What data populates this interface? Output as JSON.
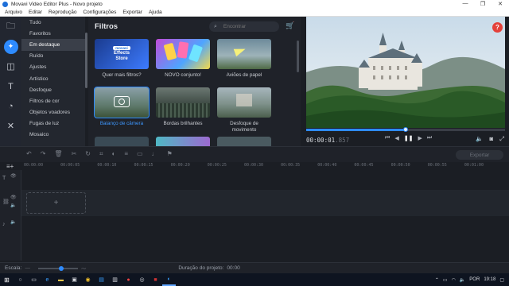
{
  "window": {
    "title": "Movavi Video Editor Plus - Novo projeto",
    "controls": [
      "—",
      "❐",
      "✕"
    ]
  },
  "menu": [
    "Arquivo",
    "Editar",
    "Reprodução",
    "Configurações",
    "Exportar",
    "Ajuda"
  ],
  "categories": [
    "Tudo",
    "Favoritos",
    "Em destaque",
    "Ruído",
    "Ajustes",
    "Artístico",
    "Desfoque",
    "Filtros de cor",
    "Objetos voadores",
    "Fugas de luz",
    "Mosaico"
  ],
  "categories_active": "Em destaque",
  "library": {
    "title": "Filtros",
    "search_placeholder": "Encontrar",
    "tiles": [
      {
        "caption": "Quer mais filtros?",
        "badge_top": "movavi",
        "badge_text": "Effects Store"
      },
      {
        "caption": "NOVO conjunto!"
      },
      {
        "caption": "Aviões de papel"
      },
      {
        "caption": "Balanço de câmera",
        "selected": true
      },
      {
        "caption": "Bordas brilhantes"
      },
      {
        "caption": "Desfoque de movimento"
      }
    ]
  },
  "preview": {
    "help": "?",
    "timecode_main": "00:00:01",
    "timecode_ms": ".857",
    "progress": 0.5
  },
  "timeline": {
    "export_label": "Exportar",
    "ruler": [
      "00:00:00",
      "00:00:05",
      "00:00:10",
      "00:00:15",
      "00:00:20",
      "00:00:25",
      "00:00:30",
      "00:00:35",
      "00:00:40",
      "00:00:45",
      "00:00:50",
      "00:00:55",
      "00:01:00"
    ],
    "drop_symbol": "+"
  },
  "status": {
    "scale_label": "Escala:",
    "duration_label": "Duração do projeto:",
    "duration_value": "00:00"
  },
  "taskbar": {
    "lang": "POR",
    "time": "19:18"
  },
  "colors": {
    "accent": "#2e8bff",
    "help": "#e4413a",
    "background": "#1b1e24"
  }
}
